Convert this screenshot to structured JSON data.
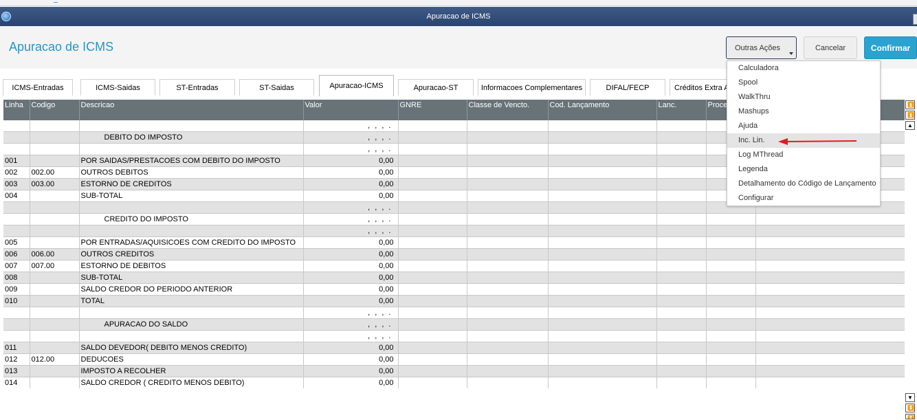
{
  "window": {
    "title": "Apuracao de ICMS"
  },
  "header": {
    "title": "Apuracao de ICMS"
  },
  "buttons": {
    "outras_acoes": "Outras Ações",
    "cancelar": "Cancelar",
    "confirmar": "Confirmar"
  },
  "tabs": [
    "ICMS-Entradas",
    "ICMS-Saidas",
    "ST-Entradas",
    "ST-Saidas",
    "Apuracao-ICMS",
    "Apuracao-ST",
    "Informacoes Complementares",
    "DIFAL/FECP",
    "Créditos Extra A"
  ],
  "active_tab": "Apuracao-ICMS",
  "grid": {
    "columns": [
      "Linha",
      "Codigo",
      "Descricao",
      "Valor",
      "GNRE",
      "Classe de Vencto.",
      "Cod. Lançamento",
      "Lanc.",
      "Proce",
      ""
    ],
    "rows": [
      [
        "",
        "",
        "",
        ", , , ."
      ],
      [
        "",
        "",
        "DEBITO DO IMPOSTO",
        ", , , ."
      ],
      [
        "",
        "",
        "",
        ", , , ."
      ],
      [
        "001",
        "",
        "POR SAIDAS/PRESTACOES COM DEBITO DO IMPOSTO",
        "0,00"
      ],
      [
        "002",
        "002.00",
        "OUTROS DEBITOS",
        "0,00"
      ],
      [
        "003",
        "003.00",
        "ESTORNO DE CREDITOS",
        "0,00"
      ],
      [
        "004",
        "",
        "SUB-TOTAL",
        "0,00"
      ],
      [
        "",
        "",
        "",
        ", , , ."
      ],
      [
        "",
        "",
        "CREDITO DO IMPOSTO",
        ", , , ."
      ],
      [
        "",
        "",
        "",
        ", , , ."
      ],
      [
        "005",
        "",
        "POR ENTRADAS/AQUISICOES COM CREDITO DO IMPOSTO",
        "0,00"
      ],
      [
        "006",
        "006.00",
        "OUTROS CREDITOS",
        "0,00"
      ],
      [
        "007",
        "007.00",
        "ESTORNO DE DEBITOS",
        "0,00"
      ],
      [
        "008",
        "",
        "SUB-TOTAL",
        "0,00"
      ],
      [
        "009",
        "",
        "SALDO CREDOR DO PERIODO ANTERIOR",
        "0,00"
      ],
      [
        "010",
        "",
        "TOTAL",
        "0,00"
      ],
      [
        "",
        "",
        "",
        ", , , ."
      ],
      [
        "",
        "",
        "APURACAO DO SALDO",
        ", , , ."
      ],
      [
        "",
        "",
        "",
        ", , , ."
      ],
      [
        "011",
        "",
        "SALDO DEVEDOR( DEBITO MENOS CREDITO)",
        "0,00"
      ],
      [
        "012",
        "012.00",
        "DEDUCOES",
        "0,00"
      ],
      [
        "013",
        "",
        "IMPOSTO A RECOLHER",
        "0,00"
      ],
      [
        "014",
        "",
        "SALDO CREDOR ( CREDITO MENOS DEBITO)",
        "0,00"
      ]
    ]
  },
  "menu": {
    "items": [
      "Calculadora",
      "Spool",
      "WalkThru",
      "Mashups",
      "Ajuda",
      "Inc. Lin.",
      "Log MThread",
      "Legenda",
      "Detalhamento do Código de Lançamento",
      "Configurar"
    ],
    "highlighted": "Inc. Lin."
  },
  "colors": {
    "accent": "#2696c9",
    "confirm": "#2aa3d1",
    "header_row": "#687378",
    "annotation_arrow": "#e8191e"
  }
}
